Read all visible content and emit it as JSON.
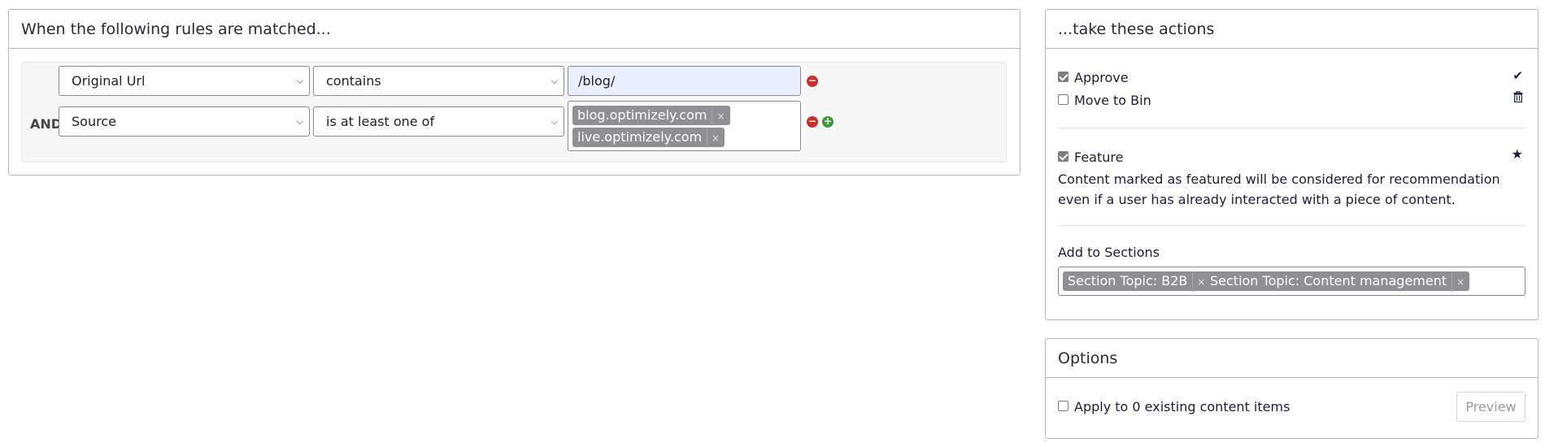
{
  "rules": {
    "title": "When the following rules are matched...",
    "rows": [
      {
        "conjunction": "",
        "field": "Original Url",
        "operator": "contains",
        "value": "/blog/"
      },
      {
        "conjunction": "AND",
        "field": "Source",
        "operator": "is at least one of",
        "tags": [
          "blog.optimizely.com",
          "live.optimizely.com"
        ]
      }
    ],
    "tag_remove": "×",
    "remove_icon": "minus-circle",
    "add_icon": "plus-circle"
  },
  "actions": {
    "title": "...take these actions",
    "approve": {
      "label": "Approve",
      "checked": true,
      "icon": "check-icon"
    },
    "move_to_bin": {
      "label": "Move to Bin",
      "checked": false,
      "icon": "trash-icon"
    },
    "feature": {
      "label": "Feature",
      "checked": true,
      "icon": "star-icon",
      "description": "Content marked as featured will be considered for recommendation even if a user has already interacted with a piece of content."
    },
    "sections": {
      "label": "Add to Sections",
      "tags": [
        "Section Topic: B2B",
        "Section Topic: Content management"
      ]
    }
  },
  "options": {
    "title": "Options",
    "apply_label": "Apply to 0 existing content items",
    "apply_checked": false,
    "preview_label": "Preview"
  },
  "colors": {
    "remove": "#c9302c",
    "add": "#3c9a3c",
    "tag_bg": "#8f8f94",
    "autofill_bg": "#e8f0fe"
  }
}
